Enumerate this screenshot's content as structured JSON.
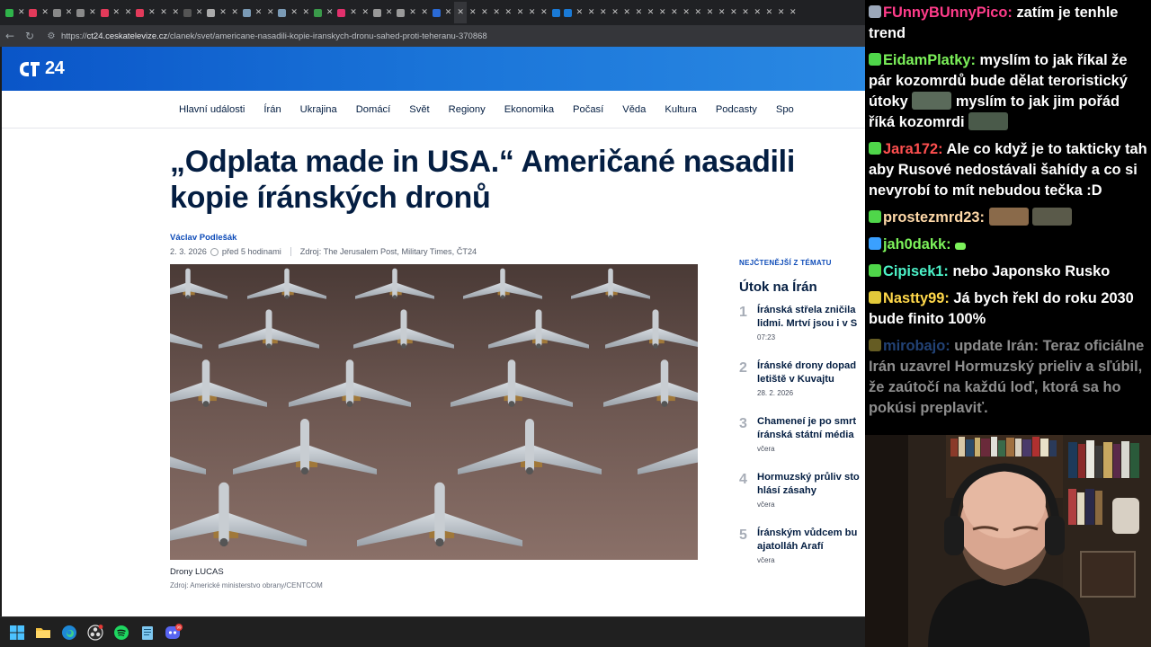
{
  "browser": {
    "url_prefix": "https://",
    "url_host": "ct24.ceskatelevize.cz",
    "url_path": "/clanek/svet/americane-nasadili-kopie-iranskych-dronu-sahed-proti-teheranu-370868"
  },
  "site": {
    "logo_text": "24",
    "nav": [
      "Hlavní události",
      "Írán",
      "Ukrajina",
      "Domácí",
      "Svět",
      "Regiony",
      "Ekonomika",
      "Počasí",
      "Věda",
      "Kultura",
      "Podcasty",
      "Spo"
    ]
  },
  "article": {
    "headline": "„Odplata made in USA.“ Američané nasadili kopie íránských dronů",
    "author": "Václav Podlešák",
    "date": "2. 3. 2026",
    "relative_time": "před 5 hodinami",
    "source": "Zdroj: The Jerusalem Post, Military Times, ČT24",
    "image_caption": "Drony LUCAS",
    "image_credit": "Zdroj: Americké ministerstvo obrany/CENTCOM"
  },
  "sidebar": {
    "kicker": "NEJČTENĚJŠÍ Z TÉMATU",
    "title": "Útok na Írán",
    "items": [
      {
        "num": "1",
        "line1": "Íránská střela zničila",
        "line2": "lidmi. Mrtví jsou i v S",
        "time": "07:23"
      },
      {
        "num": "2",
        "line1": "Íránské drony dopad",
        "line2": "letiště v Kuvajtu",
        "time": "28. 2. 2026"
      },
      {
        "num": "3",
        "line1": "Chameneí je po smrt",
        "line2": "íránská státní média",
        "time": "včera"
      },
      {
        "num": "4",
        "line1": "Hormuzský průliv sto",
        "line2": "hlásí zásahy",
        "time": "včera"
      },
      {
        "num": "5",
        "line1": "Íránským vůdcem bu",
        "line2": "ajatolláh Arafí",
        "time": "včera"
      }
    ]
  },
  "chat": [
    {
      "user": "FUnnyBUnnyPico",
      "color": "#ff3c8a",
      "text": "zatím je tenhle trend",
      "badge": "#9aa6b8"
    },
    {
      "user": "EidamPlatky",
      "color": "#7cf25a",
      "text": "myslím to jak říkal že pár kozomrdů bude dělat teroristický útoky",
      "text2": "myslím to jak jim pořád říká kozomrdi",
      "badge": "#4fd64a"
    },
    {
      "user": "Jara172",
      "color": "#ff4f4f",
      "text": "Ale co když je to takticky tah aby Rusové nedostávali šahídy a co si nevyrobí to mít nebudou tečka :D",
      "badge": "#4fd64a"
    },
    {
      "user": "prostezmrd23",
      "color": "#ffd9a8",
      "text": "",
      "badge": "#4fd64a"
    },
    {
      "user": "jah0dakk",
      "color": "#7cf25a",
      "text": "",
      "badge": "#3aa0ff"
    },
    {
      "user": "Cipisek1",
      "color": "#4cf2c8",
      "text": "nebo Japonsko Rusko",
      "badge": "#4fd64a"
    },
    {
      "user": "Nastty99",
      "color": "#ffd84a",
      "text": "Já bych řekl do roku 2030 bude finito 100%",
      "badge": "#e2c93a"
    },
    {
      "user": "mirobajo",
      "color": "#3f78d6",
      "text": "update Irán: Teraz oficiálne Irán uzavrel Hormuzský prieliv a sľúbil, že zaútočí na každú loď, ktorá sa ho pokúsi preplaviť.",
      "badge": "#b8a840"
    }
  ],
  "taskbar": {
    "discord_badge": "99"
  }
}
